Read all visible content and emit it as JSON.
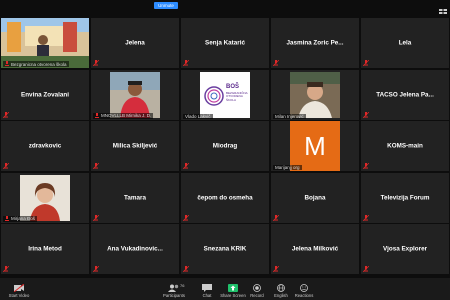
{
  "top": {
    "unmute_label": "Unmute",
    "view_icon": "view-grid-icon"
  },
  "tiles": [
    {
      "kind": "video-wide",
      "label": "Bezgranicna otvorena škola",
      "speaking": true
    },
    {
      "kind": "name",
      "name": "Jelena"
    },
    {
      "kind": "name",
      "name": "Senja Katarić"
    },
    {
      "kind": "name",
      "name": "Jasmina Zoric Pe..."
    },
    {
      "kind": "name",
      "name": "Lela"
    },
    {
      "kind": "name",
      "name": "Envina Zovalani"
    },
    {
      "kind": "video",
      "label": "MNOVLLLB Mirnika J. D."
    },
    {
      "kind": "logo",
      "label": "Vlado Lakvič",
      "logo_title": "BOŠ",
      "logo_sub1": "BEZGRANIČNA",
      "logo_sub2": "OTVORENA",
      "logo_sub3": "ŠKOLA"
    },
    {
      "kind": "video",
      "label": "Milan Injerović"
    },
    {
      "kind": "name",
      "name": "TACSO Jelena Pa..."
    },
    {
      "kind": "name",
      "name": "zdravkovic"
    },
    {
      "kind": "name",
      "name": "Milica Škiljević"
    },
    {
      "kind": "name",
      "name": "Miodrag"
    },
    {
      "kind": "initial",
      "initial": "M",
      "label": "Marijanjj org"
    },
    {
      "kind": "name",
      "name": "KOMS-main"
    },
    {
      "kind": "video",
      "label": "Mirjana Đoš"
    },
    {
      "kind": "name",
      "name": "Tamara"
    },
    {
      "kind": "name",
      "name": "čepom do osmeha"
    },
    {
      "kind": "name",
      "name": "Bojana"
    },
    {
      "kind": "name",
      "name": "Televizija Forum"
    },
    {
      "kind": "name",
      "name": "Irina Metod"
    },
    {
      "kind": "name",
      "name": "Ana  Vukadinovic..."
    },
    {
      "kind": "name",
      "name": "Snezana KRIK"
    },
    {
      "kind": "name",
      "name": "Jelena Milković"
    },
    {
      "kind": "name",
      "name": "Vjosa Explorer"
    }
  ],
  "toolbar": {
    "start_video": "Start Video",
    "participants": "Participants",
    "participants_count": "76",
    "chat": "Chat",
    "share_screen": "Share Screen",
    "record": "Record",
    "english": "English",
    "reactions": "Reactions"
  },
  "colors": {
    "tile_bg": "#222222",
    "speaking": "#e7e100",
    "accent_blue": "#2d8cff",
    "share_green": "#1fc16b",
    "initial_orange": "#e56b15",
    "mute_red": "#e02828"
  }
}
